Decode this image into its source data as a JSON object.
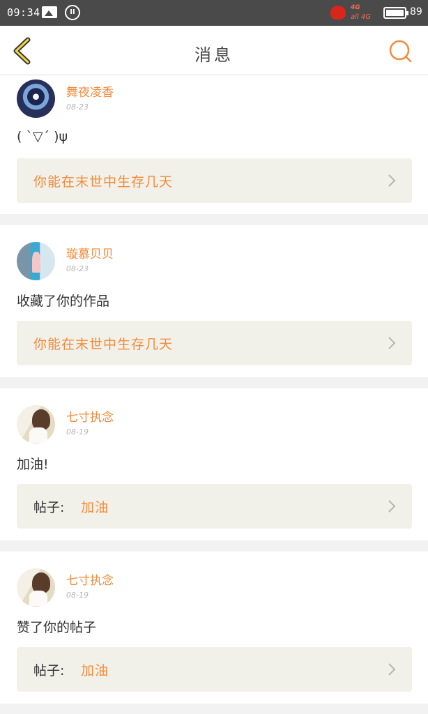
{
  "status_bar": {
    "time": "09:34",
    "network": "4G",
    "signal_text": "all 4G",
    "battery_level": "89",
    "icons": [
      "image-icon",
      "pause-icon",
      "pet-app-icon",
      "battery-icon"
    ]
  },
  "header": {
    "title": "消息",
    "back_icon": "chevron-left-icon",
    "search_icon": "search-icon",
    "accent": "#f28b3c"
  },
  "messages": [
    {
      "user": "舞夜凌香",
      "date": "08-23",
      "content": "( ˋ▽ˊ )ψ",
      "link_label": "",
      "link_title": "你能在末世中生存几天"
    },
    {
      "user": "璇慕贝贝",
      "date": "08-23",
      "content": "收藏了你的作品",
      "link_label": "",
      "link_title": "你能在末世中生存几天"
    },
    {
      "user": "七寸执念",
      "date": "08-19",
      "content": "加油!",
      "link_label": "帖子:",
      "link_title": "加油"
    },
    {
      "user": "七寸执念",
      "date": "08-19",
      "content": "赞了你的帖子",
      "link_label": "帖子:",
      "link_title": "加油"
    }
  ]
}
